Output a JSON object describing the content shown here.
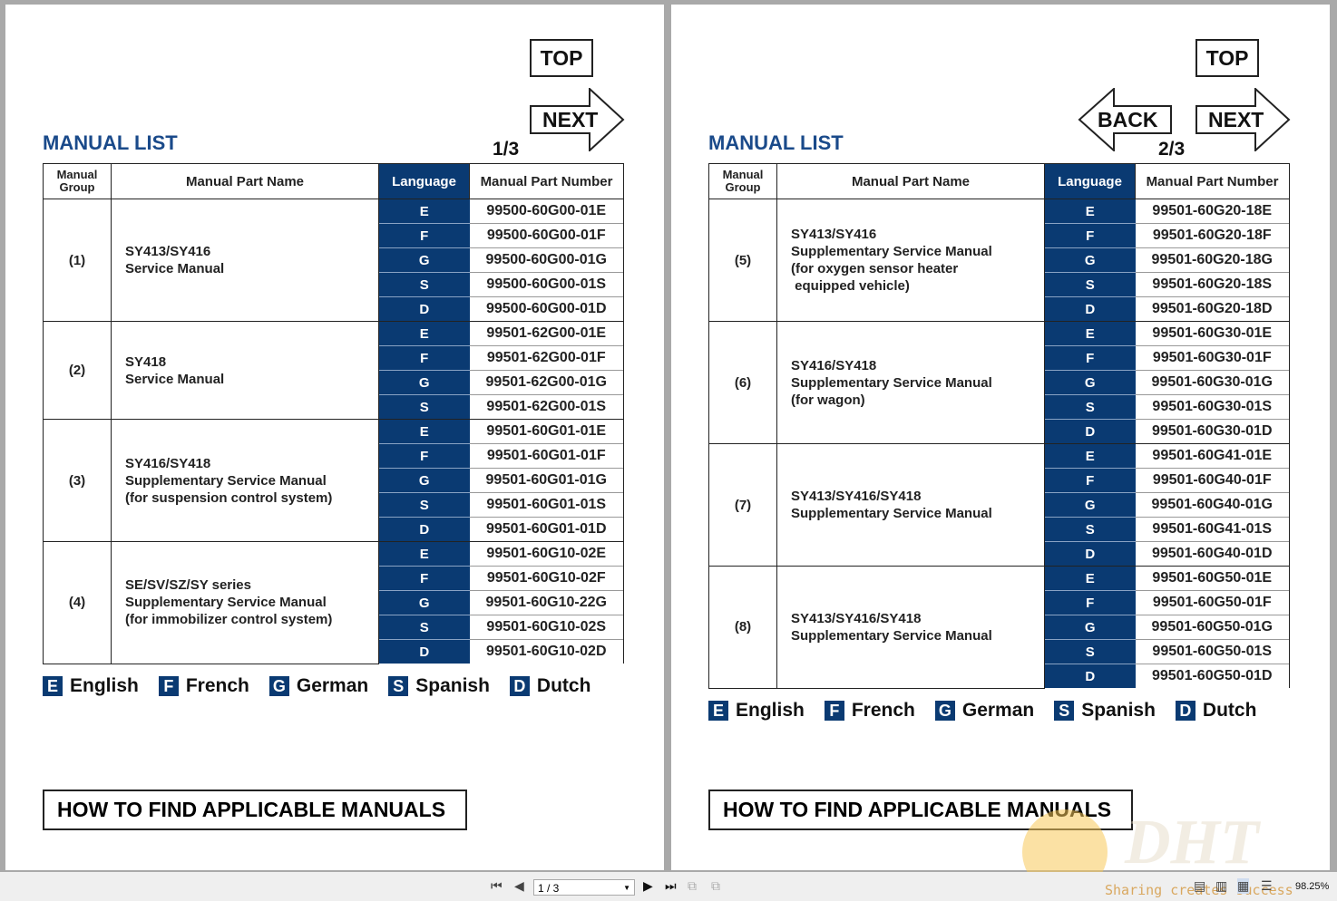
{
  "pages": [
    {
      "title": "MANUAL LIST",
      "page_indicator": "1/3",
      "top": "TOP",
      "next": "NEXT",
      "headers": {
        "group": "Manual Group",
        "name": "Manual Part Name",
        "lang": "Language",
        "number": "Manual Part Number"
      },
      "groups": [
        {
          "group": "(1)",
          "name": [
            "SY413/SY416",
            "Service Manual"
          ],
          "rows": [
            [
              "E",
              "99500-60G00-01E"
            ],
            [
              "F",
              "99500-60G00-01F"
            ],
            [
              "G",
              "99500-60G00-01G"
            ],
            [
              "S",
              "99500-60G00-01S"
            ],
            [
              "D",
              "99500-60G00-01D"
            ]
          ]
        },
        {
          "group": "(2)",
          "name": [
            "SY418",
            "Service Manual"
          ],
          "rows": [
            [
              "E",
              "99501-62G00-01E"
            ],
            [
              "F",
              "99501-62G00-01F"
            ],
            [
              "G",
              "99501-62G00-01G"
            ],
            [
              "S",
              "99501-62G00-01S"
            ]
          ]
        },
        {
          "group": "(3)",
          "name": [
            "SY416/SY418",
            "Supplementary Service Manual",
            "(for suspension control system)"
          ],
          "rows": [
            [
              "E",
              "99501-60G01-01E"
            ],
            [
              "F",
              "99501-60G01-01F"
            ],
            [
              "G",
              "99501-60G01-01G"
            ],
            [
              "S",
              "99501-60G01-01S"
            ],
            [
              "D",
              "99501-60G01-01D"
            ]
          ]
        },
        {
          "group": "(4)",
          "name": [
            "SE/SV/SZ/SY series",
            "Supplementary Service Manual",
            "(for immobilizer control system)"
          ],
          "rows": [
            [
              "E",
              "99501-60G10-02E"
            ],
            [
              "F",
              "99501-60G10-02F"
            ],
            [
              "G",
              "99501-60G10-22G"
            ],
            [
              "S",
              "99501-60G10-02S"
            ],
            [
              "D",
              "99501-60G10-02D"
            ]
          ]
        }
      ],
      "howto": "HOW TO FIND APPLICABLE MANUALS"
    },
    {
      "title": "MANUAL LIST",
      "page_indicator": "2/3",
      "top": "TOP",
      "back": "BACK",
      "next": "NEXT",
      "headers": {
        "group": "Manual Group",
        "name": "Manual Part Name",
        "lang": "Language",
        "number": "Manual Part Number"
      },
      "groups": [
        {
          "group": "(5)",
          "name": [
            "SY413/SY416",
            "Supplementary Service Manual",
            "(for oxygen sensor heater",
            " equipped vehicle)"
          ],
          "rows": [
            [
              "E",
              "99501-60G20-18E"
            ],
            [
              "F",
              "99501-60G20-18F"
            ],
            [
              "G",
              "99501-60G20-18G"
            ],
            [
              "S",
              "99501-60G20-18S"
            ],
            [
              "D",
              "99501-60G20-18D"
            ]
          ]
        },
        {
          "group": "(6)",
          "name": [
            "SY416/SY418",
            "Supplementary Service Manual",
            "(for wagon)"
          ],
          "rows": [
            [
              "E",
              "99501-60G30-01E"
            ],
            [
              "F",
              "99501-60G30-01F"
            ],
            [
              "G",
              "99501-60G30-01G"
            ],
            [
              "S",
              "99501-60G30-01S"
            ],
            [
              "D",
              "99501-60G30-01D"
            ]
          ]
        },
        {
          "group": "(7)",
          "name": [
            "SY413/SY416/SY418",
            "Supplementary Service Manual"
          ],
          "rows": [
            [
              "E",
              "99501-60G41-01E"
            ],
            [
              "F",
              "99501-60G40-01F"
            ],
            [
              "G",
              "99501-60G40-01G"
            ],
            [
              "S",
              "99501-60G41-01S"
            ],
            [
              "D",
              "99501-60G40-01D"
            ]
          ]
        },
        {
          "group": "(8)",
          "name": [
            "SY413/SY416/SY418",
            "Supplementary Service Manual"
          ],
          "rows": [
            [
              "E",
              "99501-60G50-01E"
            ],
            [
              "F",
              "99501-60G50-01F"
            ],
            [
              "G",
              "99501-60G50-01G"
            ],
            [
              "S",
              "99501-60G50-01S"
            ],
            [
              "D",
              "99501-60G50-01D"
            ]
          ]
        }
      ],
      "howto": "HOW TO FIND APPLICABLE MANUALS"
    }
  ],
  "legend": [
    [
      "E",
      "English"
    ],
    [
      "F",
      "French"
    ],
    [
      "G",
      "German"
    ],
    [
      "S",
      "Spanish"
    ],
    [
      "D",
      "Dutch"
    ]
  ],
  "toolbar": {
    "page_value": "1 / 3",
    "zoom": "98.25%",
    "watermark": "Sharing creates success",
    "watermark_logo": "DHT"
  },
  "colors": {
    "brand_blue": "#0a3a72",
    "title_blue": "#1a4a8a"
  }
}
